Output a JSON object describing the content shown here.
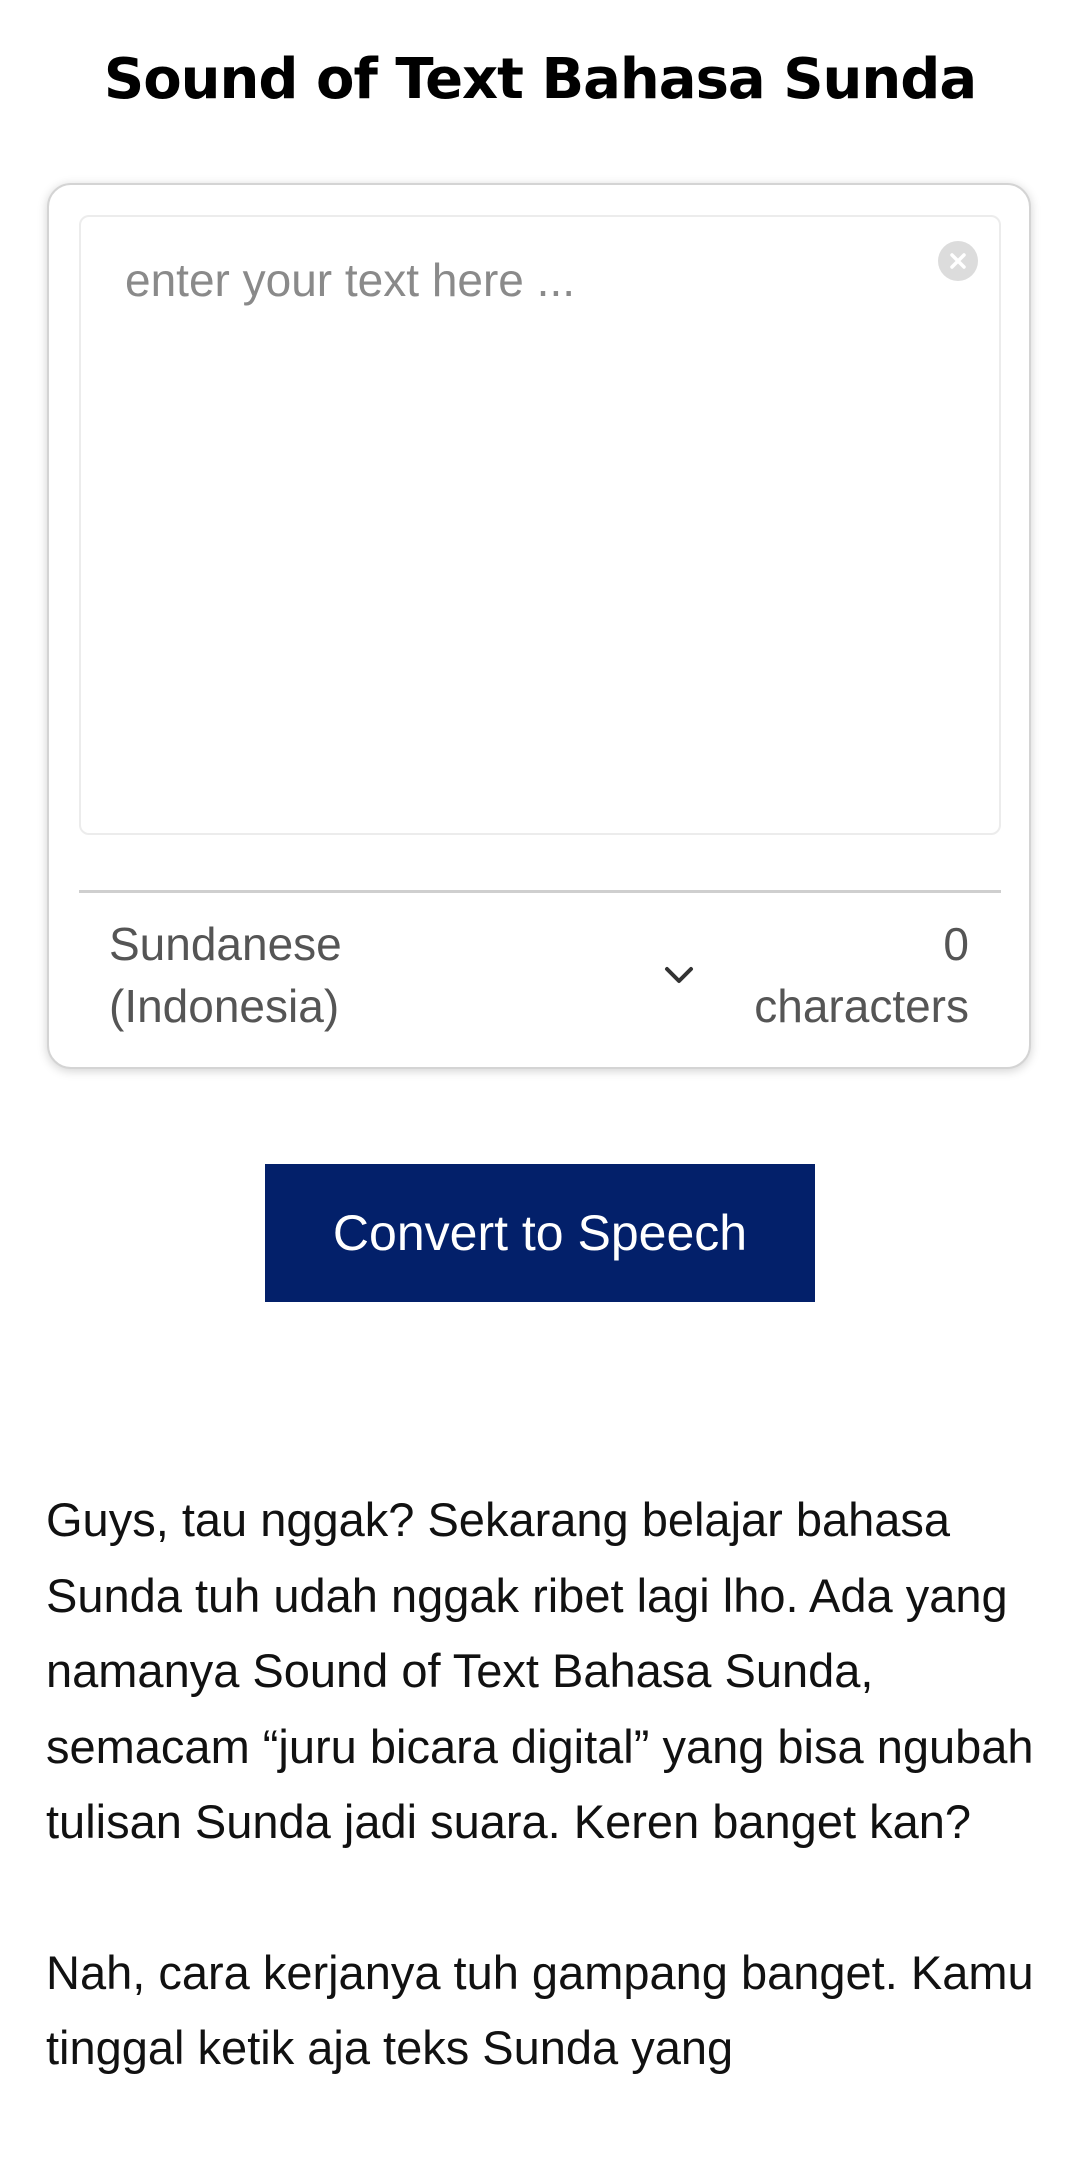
{
  "page": {
    "title": "Sound of Text Bahasa Sunda"
  },
  "editor": {
    "placeholder": "enter your text here ...",
    "value": "",
    "clear_icon": "close-circle-icon",
    "language_line1": "Sundanese",
    "language_line2": "(Indonesia)",
    "dropdown_icon": "chevron-down-icon",
    "char_count": "0",
    "char_label": "characters"
  },
  "actions": {
    "convert_label": "Convert to Speech"
  },
  "article": {
    "paragraphs": [
      "Guys, tau nggak? Sekarang belajar bahasa Sunda tuh udah nggak ribet lagi lho. Ada yang namanya Sound of Text Bahasa Sunda, semacam “juru bicara digital” yang bisa ngubah tulisan Sunda jadi suara. Keren banget kan?",
      "Nah, cara kerjanya tuh gampang banget. Kamu tinggal ketik aja teks Sunda yang"
    ]
  },
  "colors": {
    "button_bg": "#03206a",
    "button_text": "#ffffff",
    "card_border": "#d4d4d4",
    "muted_text": "#555555",
    "placeholder": "#8a8a8a"
  }
}
